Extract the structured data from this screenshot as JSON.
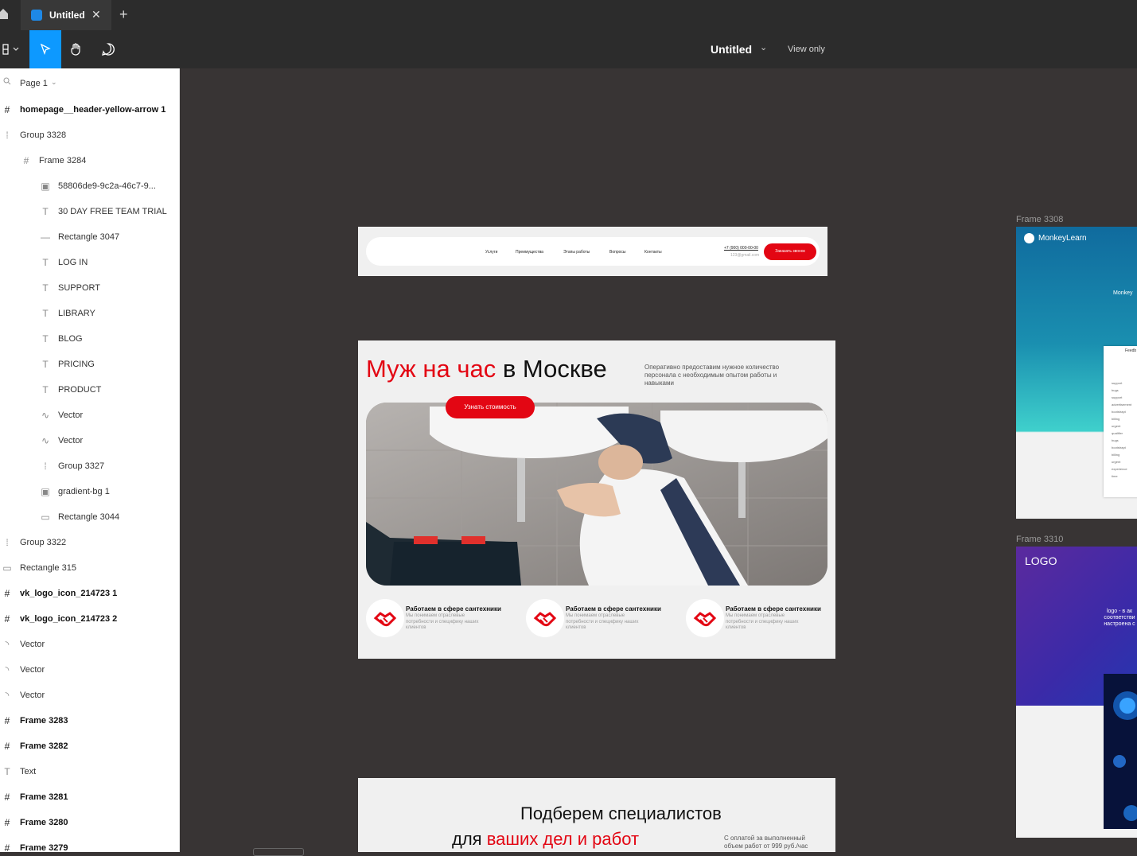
{
  "tabbar": {
    "tab_title": "Untitled",
    "close_glyph": "✕",
    "new_tab_glyph": "+"
  },
  "toolbar": {
    "doc_title": "Untitled",
    "view_only": "View only",
    "tools": [
      "main-menu",
      "move",
      "hand",
      "comment"
    ]
  },
  "layers_panel": {
    "page_label": "Page 1",
    "items": [
      {
        "label": "homepage__header-yellow-arrow 1",
        "icon": "frame",
        "indent": 0,
        "bold": true
      },
      {
        "label": "Group 3328",
        "icon": "group",
        "indent": 0,
        "bold": false
      },
      {
        "label": "Frame 3284",
        "icon": "frame",
        "indent": 1,
        "bold": false
      },
      {
        "label": "58806de9-9c2a-46c7-9...",
        "icon": "image",
        "indent": 2,
        "bold": false
      },
      {
        "label": "30 DAY FREE TEAM TRIAL",
        "icon": "text",
        "indent": 2,
        "bold": false
      },
      {
        "label": "Rectangle 3047",
        "icon": "line",
        "indent": 2,
        "bold": false
      },
      {
        "label": "LOG IN",
        "icon": "text",
        "indent": 2,
        "bold": false
      },
      {
        "label": "SUPPORT",
        "icon": "text",
        "indent": 2,
        "bold": false
      },
      {
        "label": "LIBRARY",
        "icon": "text",
        "indent": 2,
        "bold": false
      },
      {
        "label": "BLOG",
        "icon": "text",
        "indent": 2,
        "bold": false
      },
      {
        "label": "PRICING",
        "icon": "text",
        "indent": 2,
        "bold": false
      },
      {
        "label": "PRODUCT",
        "icon": "text",
        "indent": 2,
        "bold": false
      },
      {
        "label": "Vector",
        "icon": "vector",
        "indent": 2,
        "bold": false
      },
      {
        "label": "Vector",
        "icon": "vector",
        "indent": 2,
        "bold": false
      },
      {
        "label": "Group 3327",
        "icon": "group",
        "indent": 2,
        "bold": false
      },
      {
        "label": "gradient-bg 1",
        "icon": "image",
        "indent": 2,
        "bold": false
      },
      {
        "label": "Rectangle 3044",
        "icon": "rectangle",
        "indent": 2,
        "bold": false
      },
      {
        "label": "Group 3322",
        "icon": "group",
        "indent": 0,
        "bold": false
      },
      {
        "label": "Rectangle 315",
        "icon": "rectangle",
        "indent": 0,
        "bold": false
      },
      {
        "label": "vk_logo_icon_214723 1",
        "icon": "frame",
        "indent": 0,
        "bold": true
      },
      {
        "label": "vk_logo_icon_214723 2",
        "icon": "frame",
        "indent": 0,
        "bold": true
      },
      {
        "label": "Vector",
        "icon": "arc",
        "indent": 0,
        "bold": false
      },
      {
        "label": "Vector",
        "icon": "arc",
        "indent": 0,
        "bold": false
      },
      {
        "label": "Vector",
        "icon": "arc",
        "indent": 0,
        "bold": false
      },
      {
        "label": "Frame 3283",
        "icon": "frame",
        "indent": 0,
        "bold": true
      },
      {
        "label": "Frame 3282",
        "icon": "frame",
        "indent": 0,
        "bold": true
      },
      {
        "label": "Text",
        "icon": "text",
        "indent": 0,
        "bold": false
      },
      {
        "label": "Frame 3281",
        "icon": "frame",
        "indent": 0,
        "bold": true
      },
      {
        "label": "Frame 3280",
        "icon": "frame",
        "indent": 0,
        "bold": true
      },
      {
        "label": "Frame 3279",
        "icon": "frame",
        "indent": 0,
        "bold": true
      }
    ]
  },
  "canvas": {
    "header_frame": {
      "nav": [
        "Услуги",
        "Преимущества",
        "Этапы работы",
        "Вопросы",
        "Контакты"
      ],
      "phone": "+7 (900) 000-00-00",
      "email": "123@gmail.com",
      "cta": "Заказать звонок"
    },
    "hero_frame": {
      "title_red": "Муж на час",
      "title_black": " в Москве",
      "description": "Оперативно предоставим нужное количество персонала с необходимым опытом работы и навыками",
      "cta": "Узнать стоимость",
      "features": [
        {
          "title": "Работаем в сфере сантехники",
          "desc": "Мы понимаем отраслевые потребности и специфику наших клиентов"
        },
        {
          "title": "Работаем в сфере сантехники",
          "desc": "Мы понимаем отраслевые потребности и специфику наших клиентов"
        },
        {
          "title": "Работаем в сфере сантехники",
          "desc": "Мы понимаем отраслевые потребности и специфику наших клиентов"
        }
      ]
    },
    "specialists_frame": {
      "line1": "Подберем специалистов",
      "line2_black": "для ",
      "line2_red": "ваших дел и работ",
      "note": "С оплатой за выполненный объем работ от 999 руб./час"
    },
    "frame_3308": {
      "label": "Frame 3308",
      "brand": "MonkeyLearn",
      "headline_fragment": "Monkey",
      "panel_title": "Feedb",
      "panel_items": [
        "support",
        "bugs",
        "support",
        "advertisement",
        "bootstrapt",
        "billing",
        "urgent",
        "qualifier",
        "bugs",
        "bootstrapt",
        "billing",
        "urgent",
        "experience",
        "time"
      ]
    },
    "frame_3310": {
      "label": "Frame 3310",
      "logo": "LOGO",
      "text_fragment": "logo - в ак соответстви настроена с"
    }
  },
  "colors": {
    "accent_blue": "#0d99ff",
    "brand_red": "#e30613",
    "canvas_bg": "#383434",
    "toolbar_bg": "#2c2c2c"
  }
}
